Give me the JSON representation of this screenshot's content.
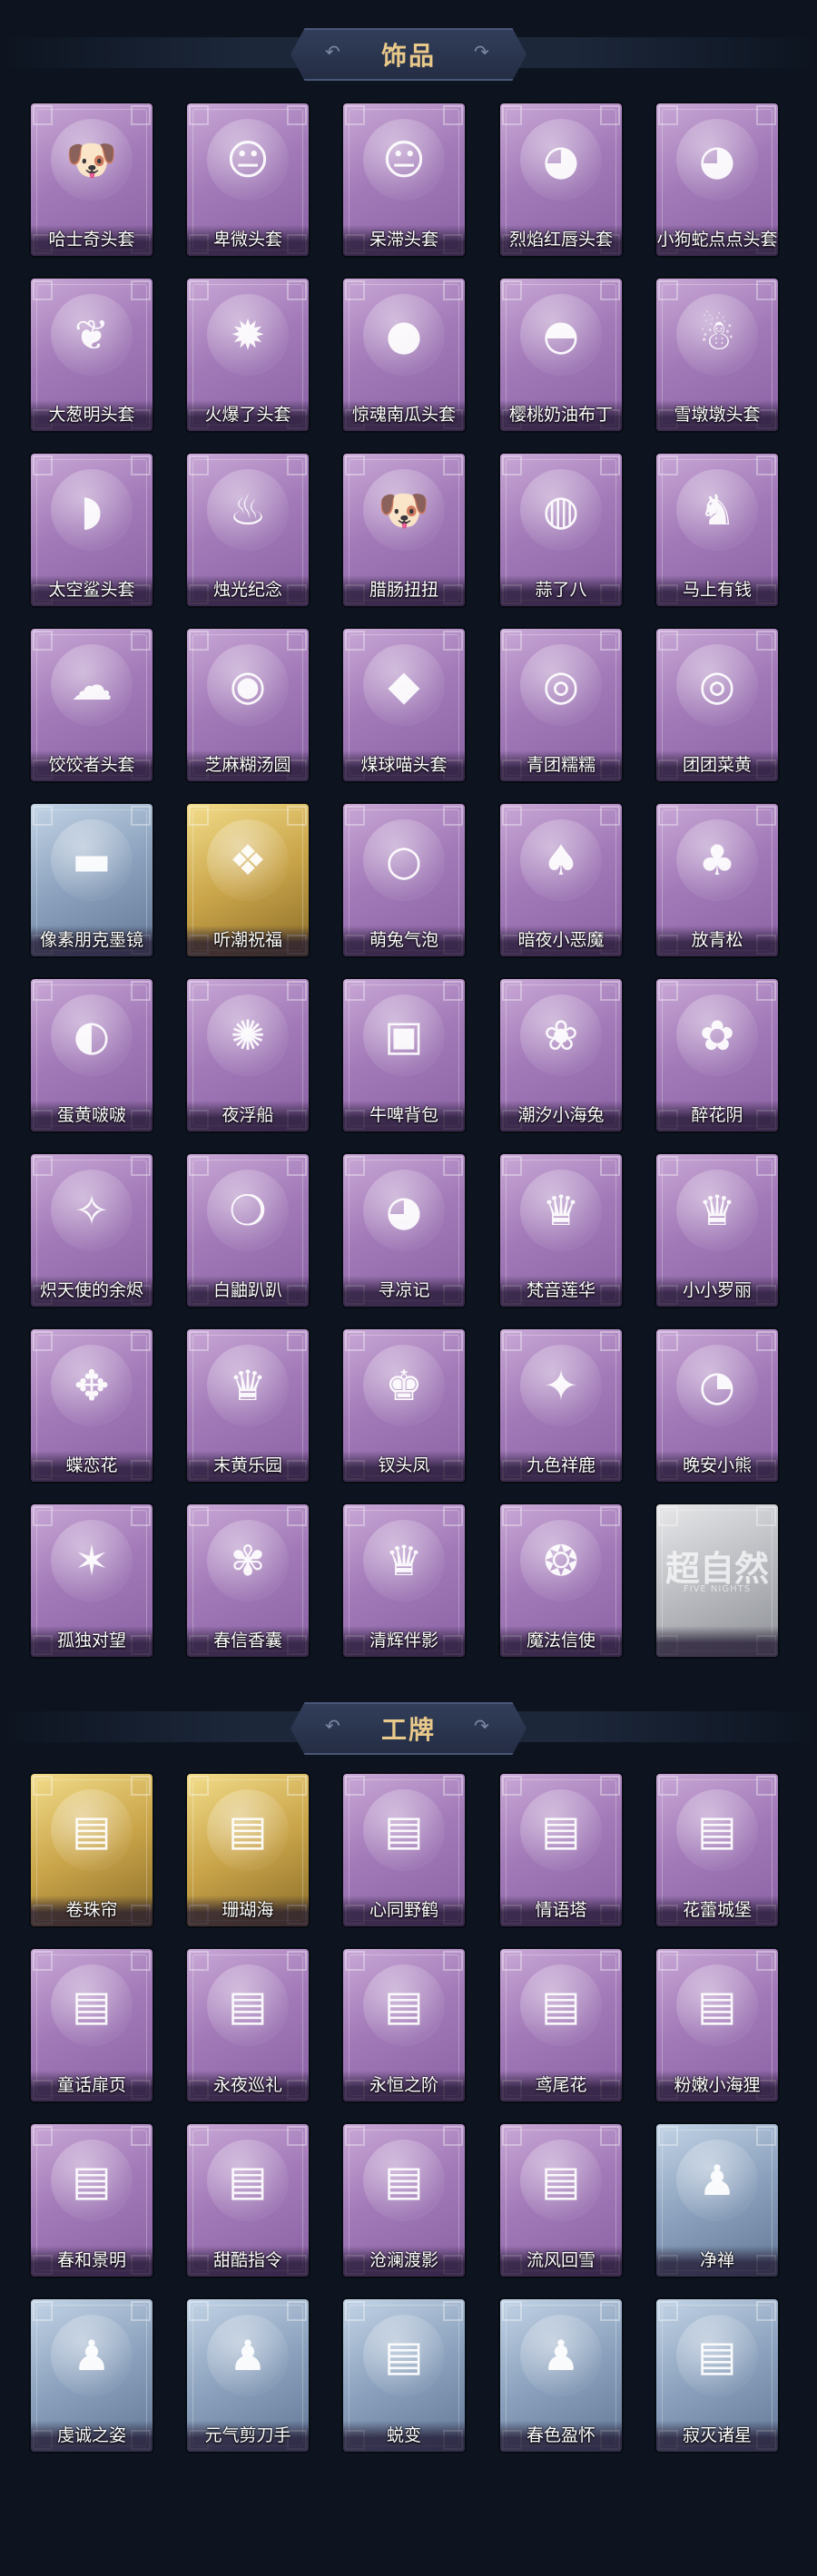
{
  "sections": [
    {
      "title": "饰品",
      "items": [
        {
          "label": "哈士奇头套",
          "rarity": "purple",
          "icon": "dog-icon"
        },
        {
          "label": "卑微头套",
          "rarity": "purple",
          "icon": "face-icon"
        },
        {
          "label": "呆滞头套",
          "rarity": "purple",
          "icon": "face-icon"
        },
        {
          "label": "烈焰红唇头套",
          "rarity": "purple",
          "icon": "creature-icon"
        },
        {
          "label": "小狗蛇点点头套",
          "rarity": "purple",
          "icon": "creature-icon"
        },
        {
          "label": "大葱明头套",
          "rarity": "purple",
          "icon": "leaf-icon"
        },
        {
          "label": "火爆了头套",
          "rarity": "purple",
          "icon": "fire-icon"
        },
        {
          "label": "惊魂南瓜头套",
          "rarity": "purple",
          "icon": "pumpkin-icon"
        },
        {
          "label": "樱桃奶油布丁",
          "rarity": "purple",
          "icon": "pudding-icon"
        },
        {
          "label": "雪墩墩头套",
          "rarity": "purple",
          "icon": "snowman-icon"
        },
        {
          "label": "太空鲨头套",
          "rarity": "purple",
          "icon": "shark-icon"
        },
        {
          "label": "烛光纪念",
          "rarity": "purple",
          "icon": "candle-icon"
        },
        {
          "label": "腊肠扭扭",
          "rarity": "purple",
          "icon": "dog-icon"
        },
        {
          "label": "蒜了八",
          "rarity": "purple",
          "icon": "garlic-icon"
        },
        {
          "label": "马上有钱",
          "rarity": "purple",
          "icon": "horse-icon"
        },
        {
          "label": "饺饺者头套",
          "rarity": "purple",
          "icon": "cloud-icon"
        },
        {
          "label": "芝麻糊汤圆",
          "rarity": "purple",
          "icon": "dumpling-icon"
        },
        {
          "label": "煤球喵头套",
          "rarity": "purple",
          "icon": "cat-icon"
        },
        {
          "label": "青团糯糯",
          "rarity": "purple",
          "icon": "bun-icon"
        },
        {
          "label": "团团菜黄",
          "rarity": "purple",
          "icon": "bun-icon"
        },
        {
          "label": "像素朋克墨镜",
          "rarity": "blue",
          "icon": "sunglasses-icon"
        },
        {
          "label": "听潮祝福",
          "rarity": "gold",
          "icon": "wings-icon"
        },
        {
          "label": "萌兔气泡",
          "rarity": "purple",
          "icon": "bubble-icon"
        },
        {
          "label": "暗夜小恶魔",
          "rarity": "purple",
          "icon": "devil-icon"
        },
        {
          "label": "放青松",
          "rarity": "purple",
          "icon": "tree-icon"
        },
        {
          "label": "蛋黄啵啵",
          "rarity": "purple",
          "icon": "chick-icon"
        },
        {
          "label": "夜浮船",
          "rarity": "purple",
          "icon": "jellyfish-icon"
        },
        {
          "label": "牛啤背包",
          "rarity": "purple",
          "icon": "backpack-icon"
        },
        {
          "label": "潮汐小海兔",
          "rarity": "purple",
          "icon": "rabbit-icon"
        },
        {
          "label": "醉花阴",
          "rarity": "purple",
          "icon": "flower-icon"
        },
        {
          "label": "炽天使的余烬",
          "rarity": "purple",
          "icon": "angel-icon"
        },
        {
          "label": "白鼬趴趴",
          "rarity": "purple",
          "icon": "ferret-icon"
        },
        {
          "label": "寻凉记",
          "rarity": "purple",
          "icon": "bear-icon"
        },
        {
          "label": "梵音莲华",
          "rarity": "purple",
          "icon": "doll-icon"
        },
        {
          "label": "小小罗丽",
          "rarity": "purple",
          "icon": "doll-icon"
        },
        {
          "label": "蝶恋花",
          "rarity": "purple",
          "icon": "bell-icon"
        },
        {
          "label": "末黄乐园",
          "rarity": "purple",
          "icon": "doll-icon"
        },
        {
          "label": "钗头凤",
          "rarity": "purple",
          "icon": "crown-icon"
        },
        {
          "label": "九色祥鹿",
          "rarity": "purple",
          "icon": "deer-icon"
        },
        {
          "label": "晚安小熊",
          "rarity": "purple",
          "icon": "teddy-icon"
        },
        {
          "label": "孤独对望",
          "rarity": "purple",
          "icon": "charm-icon"
        },
        {
          "label": "春信香囊",
          "rarity": "purple",
          "icon": "sachet-icon"
        },
        {
          "label": "清辉伴影",
          "rarity": "purple",
          "icon": "doll-icon"
        },
        {
          "label": "魔法信使",
          "rarity": "purple",
          "icon": "elephant-icon"
        },
        {
          "label": "",
          "rarity": "gray",
          "icon": "logo-icon",
          "watermark": "超自然",
          "watermark_sub": "FIVE NIGHTS"
        }
      ]
    },
    {
      "title": "工牌",
      "items": [
        {
          "label": "卷珠帘",
          "rarity": "gold",
          "icon": "card-icon"
        },
        {
          "label": "珊瑚海",
          "rarity": "gold",
          "icon": "card-icon"
        },
        {
          "label": "心同野鹤",
          "rarity": "purple",
          "icon": "card-icon"
        },
        {
          "label": "情语塔",
          "rarity": "purple",
          "icon": "card-icon"
        },
        {
          "label": "花蕾城堡",
          "rarity": "purple",
          "icon": "card-icon"
        },
        {
          "label": "童话扉页",
          "rarity": "purple",
          "icon": "card-icon"
        },
        {
          "label": "永夜巡礼",
          "rarity": "purple",
          "icon": "card-icon"
        },
        {
          "label": "永恒之阶",
          "rarity": "purple",
          "icon": "card-icon"
        },
        {
          "label": "鸢尾花",
          "rarity": "purple",
          "icon": "card-icon"
        },
        {
          "label": "粉嫩小海狸",
          "rarity": "purple",
          "icon": "card-icon"
        },
        {
          "label": "春和景明",
          "rarity": "purple",
          "icon": "card-icon"
        },
        {
          "label": "甜酷指令",
          "rarity": "purple",
          "icon": "card-icon"
        },
        {
          "label": "沧澜渡影",
          "rarity": "purple",
          "icon": "card-icon"
        },
        {
          "label": "流风回雪",
          "rarity": "purple",
          "icon": "card-icon"
        },
        {
          "label": "净禅",
          "rarity": "blue",
          "icon": "silhouette-icon"
        },
        {
          "label": "虔诚之姿",
          "rarity": "blue",
          "icon": "silhouette-icon"
        },
        {
          "label": "元气剪刀手",
          "rarity": "blue",
          "icon": "silhouette-icon"
        },
        {
          "label": "蜕变",
          "rarity": "blue",
          "icon": "card-icon"
        },
        {
          "label": "春色盈怀",
          "rarity": "blue",
          "icon": "silhouette-icon"
        },
        {
          "label": "寂灭诸星",
          "rarity": "blue",
          "icon": "card-icon"
        }
      ]
    }
  ]
}
